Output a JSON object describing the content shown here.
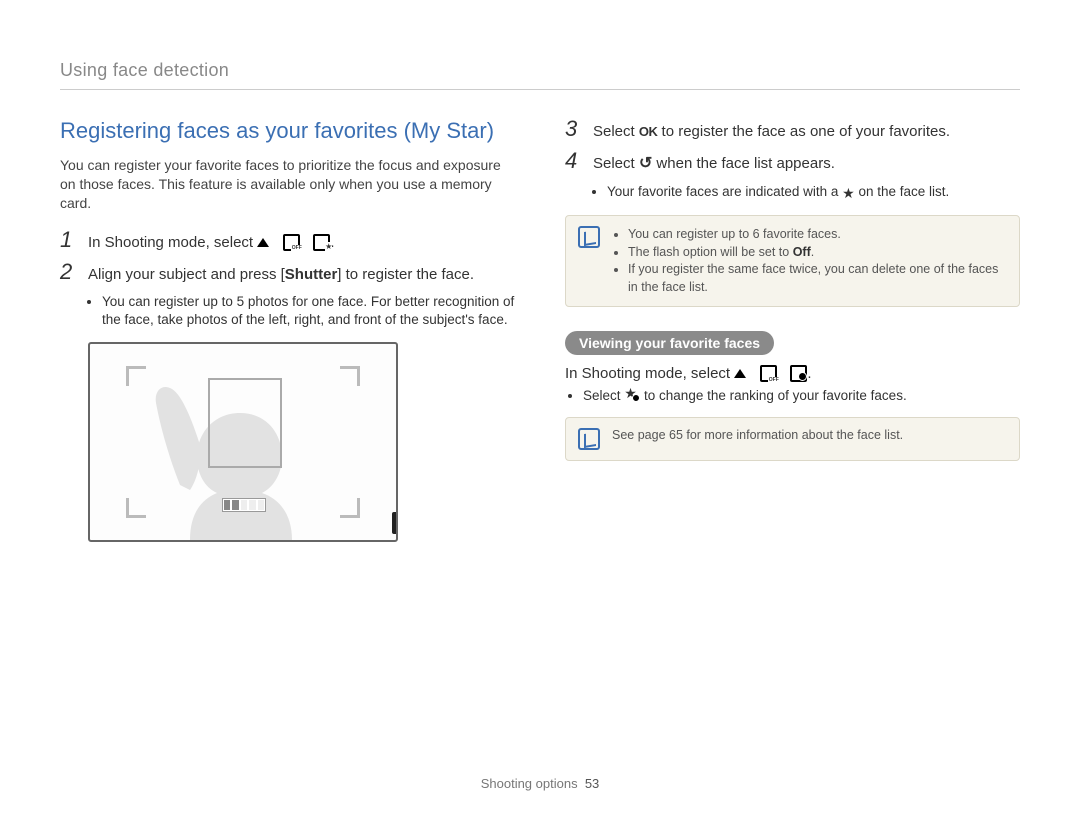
{
  "header": "Using face detection",
  "left": {
    "title": "Registering faces as your favorites (My Star)",
    "intro": "You can register your favorite faces to prioritize the focus and exposure on those faces. This feature is available only when you use a memory card.",
    "step1_num": "1",
    "step1_text": "In Shooting mode, select",
    "step2_num": "2",
    "step2_pre": "Align your subject and press [",
    "step2_shutter": "Shutter",
    "step2_post": "] to register the face.",
    "step2_bullet": "You can register up to 5 photos for one face. For better recognition of the face, take photos of the left, right, and front of the subject's face.",
    "ok_badge": "OK"
  },
  "right": {
    "step3_num": "3",
    "step3_pre": "Select ",
    "step3_post": " to register the face as one of your favorites.",
    "step4_num": "4",
    "step4_pre": "Select ",
    "step4_post": " when the face list appears.",
    "step4_bullet_pre": "Your favorite faces are indicated with a ",
    "step4_bullet_post": " on the face list.",
    "note1_a": "You can register up to 6 favorite faces.",
    "note1_b_pre": "The flash option will be set to ",
    "note1_b_off": "Off",
    "note1_b_post": ".",
    "note1_c": "If you register the same face twice, you can delete one of the faces in the face list.",
    "pill": "Viewing your favorite faces",
    "sub_text": "In Shooting mode, select",
    "sub_bullet_pre": "Select ",
    "sub_bullet_post": " to change the ranking of your favorite faces.",
    "note2": "See page 65 for more information about the face list."
  },
  "footer_label": "Shooting options",
  "footer_page": "53"
}
